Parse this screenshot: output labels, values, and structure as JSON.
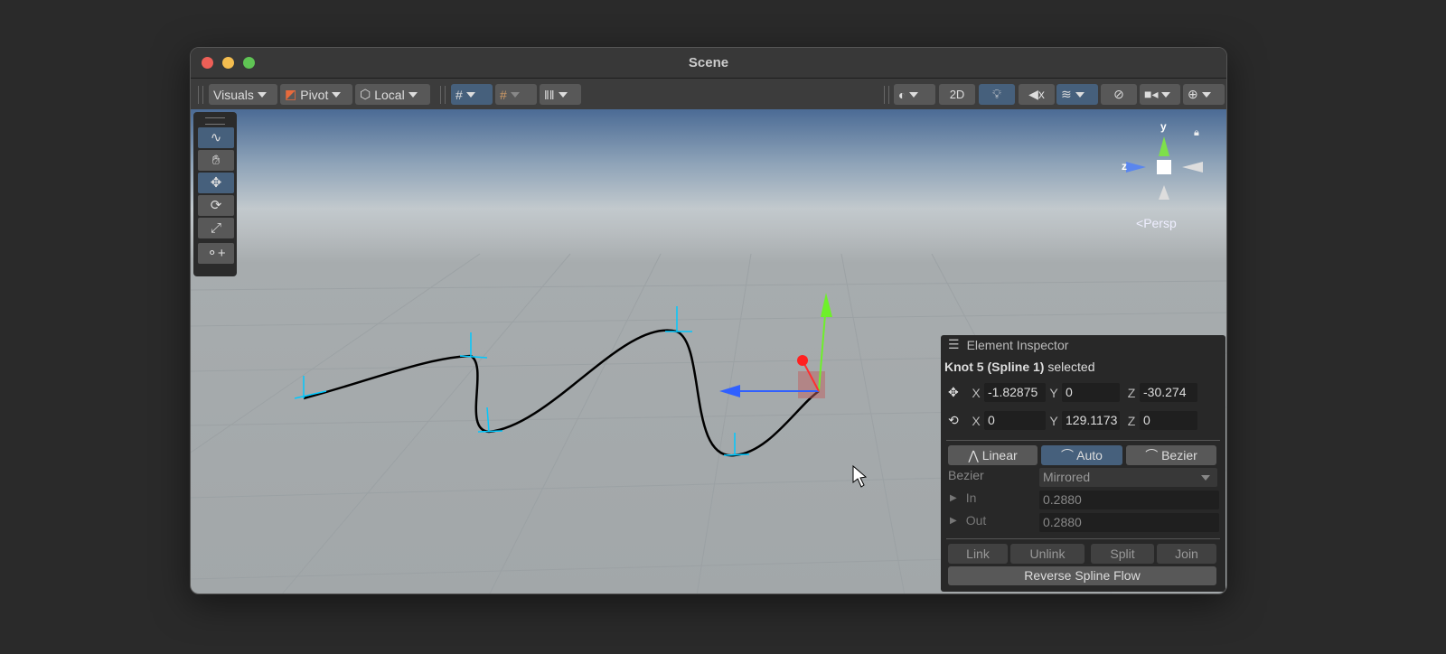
{
  "window": {
    "title": "Scene"
  },
  "toolbar": {
    "visuals": "Visuals",
    "pivot": "Pivot",
    "local": "Local",
    "mode2d": "2D"
  },
  "gizmo": {
    "y": "y",
    "z": "z",
    "projection": "Persp"
  },
  "inspector": {
    "title": "Element Inspector",
    "selection": {
      "knot": "Knot 5",
      "spline": "(Spline 1)",
      "suffix": "selected"
    },
    "position": {
      "x": "-1.82875",
      "y": "0",
      "z": "-30.274"
    },
    "rotation": {
      "x": "0",
      "y": "129.1173",
      "z": "0"
    },
    "axis": {
      "x": "X",
      "y": "Y",
      "z": "Z"
    },
    "modes": {
      "linear": "Linear",
      "auto": "Auto",
      "bezier": "Bezier"
    },
    "bezier_label": "Bezier",
    "bezier_value": "Mirrored",
    "in_label": "In",
    "in_value": "0.2880",
    "out_label": "Out",
    "out_value": "0.2880",
    "actions": {
      "link": "Link",
      "unlink": "Unlink",
      "split": "Split",
      "join": "Join",
      "reverse": "Reverse Spline Flow"
    }
  },
  "colors": {
    "accent": "#46607c",
    "spline": "#000000",
    "knot": "#00c8ff"
  }
}
